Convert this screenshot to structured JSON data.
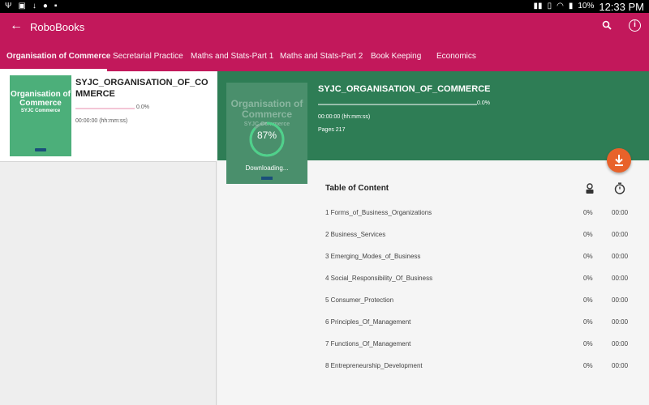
{
  "status_bar": {
    "battery": "10%",
    "time": "12:33 PM"
  },
  "app_bar": {
    "title": "RoboBooks"
  },
  "tabs": [
    {
      "label": "Organisation of Commerce",
      "active": true
    },
    {
      "label": "Secretarial Practice"
    },
    {
      "label": "Maths and Stats-Part 1"
    },
    {
      "label": "Maths and Stats-Part 2"
    },
    {
      "label": "Book Keeping"
    },
    {
      "label": "Economics"
    }
  ],
  "book_list": [
    {
      "cover_title": "Organisation of Commerce",
      "cover_subtitle": "SYJC Commerce",
      "title": "SYJC_ORGANISATION_OF_COMMERCE",
      "progress_label": "0.0%",
      "progress": 0,
      "duration": "00:00:00 (hh:mm:ss)"
    }
  ],
  "detail": {
    "cover_title": "Organisation of Commerce",
    "cover_subtitle": "SYJC Commerce",
    "download_percent": "87%",
    "download_fraction": 0.87,
    "download_status": "Downloading...",
    "title": "SYJC_ORGANISATION_OF_COMMERCE",
    "progress_label": "0.0%",
    "duration": "00:00:00 (hh:mm:ss)",
    "pages": "Pages 217"
  },
  "toc": {
    "heading": "Table of Content",
    "rows": [
      {
        "name": "1 Forms_of_Business_Organizations",
        "percent": "0%",
        "time": "00:00"
      },
      {
        "name": "2 Business_Services",
        "percent": "0%",
        "time": "00:00"
      },
      {
        "name": "3 Emerging_Modes_of_Business",
        "percent": "0%",
        "time": "00:00"
      },
      {
        "name": "4 Social_Responsibility_Of_Business",
        "percent": "0%",
        "time": "00:00"
      },
      {
        "name": "5 Consumer_Protection",
        "percent": "0%",
        "time": "00:00"
      },
      {
        "name": "6 Principles_Of_Management",
        "percent": "0%",
        "time": "00:00"
      },
      {
        "name": "7 Functions_Of_Management",
        "percent": "0%",
        "time": "00:00"
      },
      {
        "name": "8 Entrepreneurship_Development",
        "percent": "0%",
        "time": "00:00"
      }
    ]
  },
  "colors": {
    "primary": "#c2185b",
    "hero": "#2e7d55",
    "accent_fab": "#e8622a",
    "ring": "#4fd18b"
  }
}
